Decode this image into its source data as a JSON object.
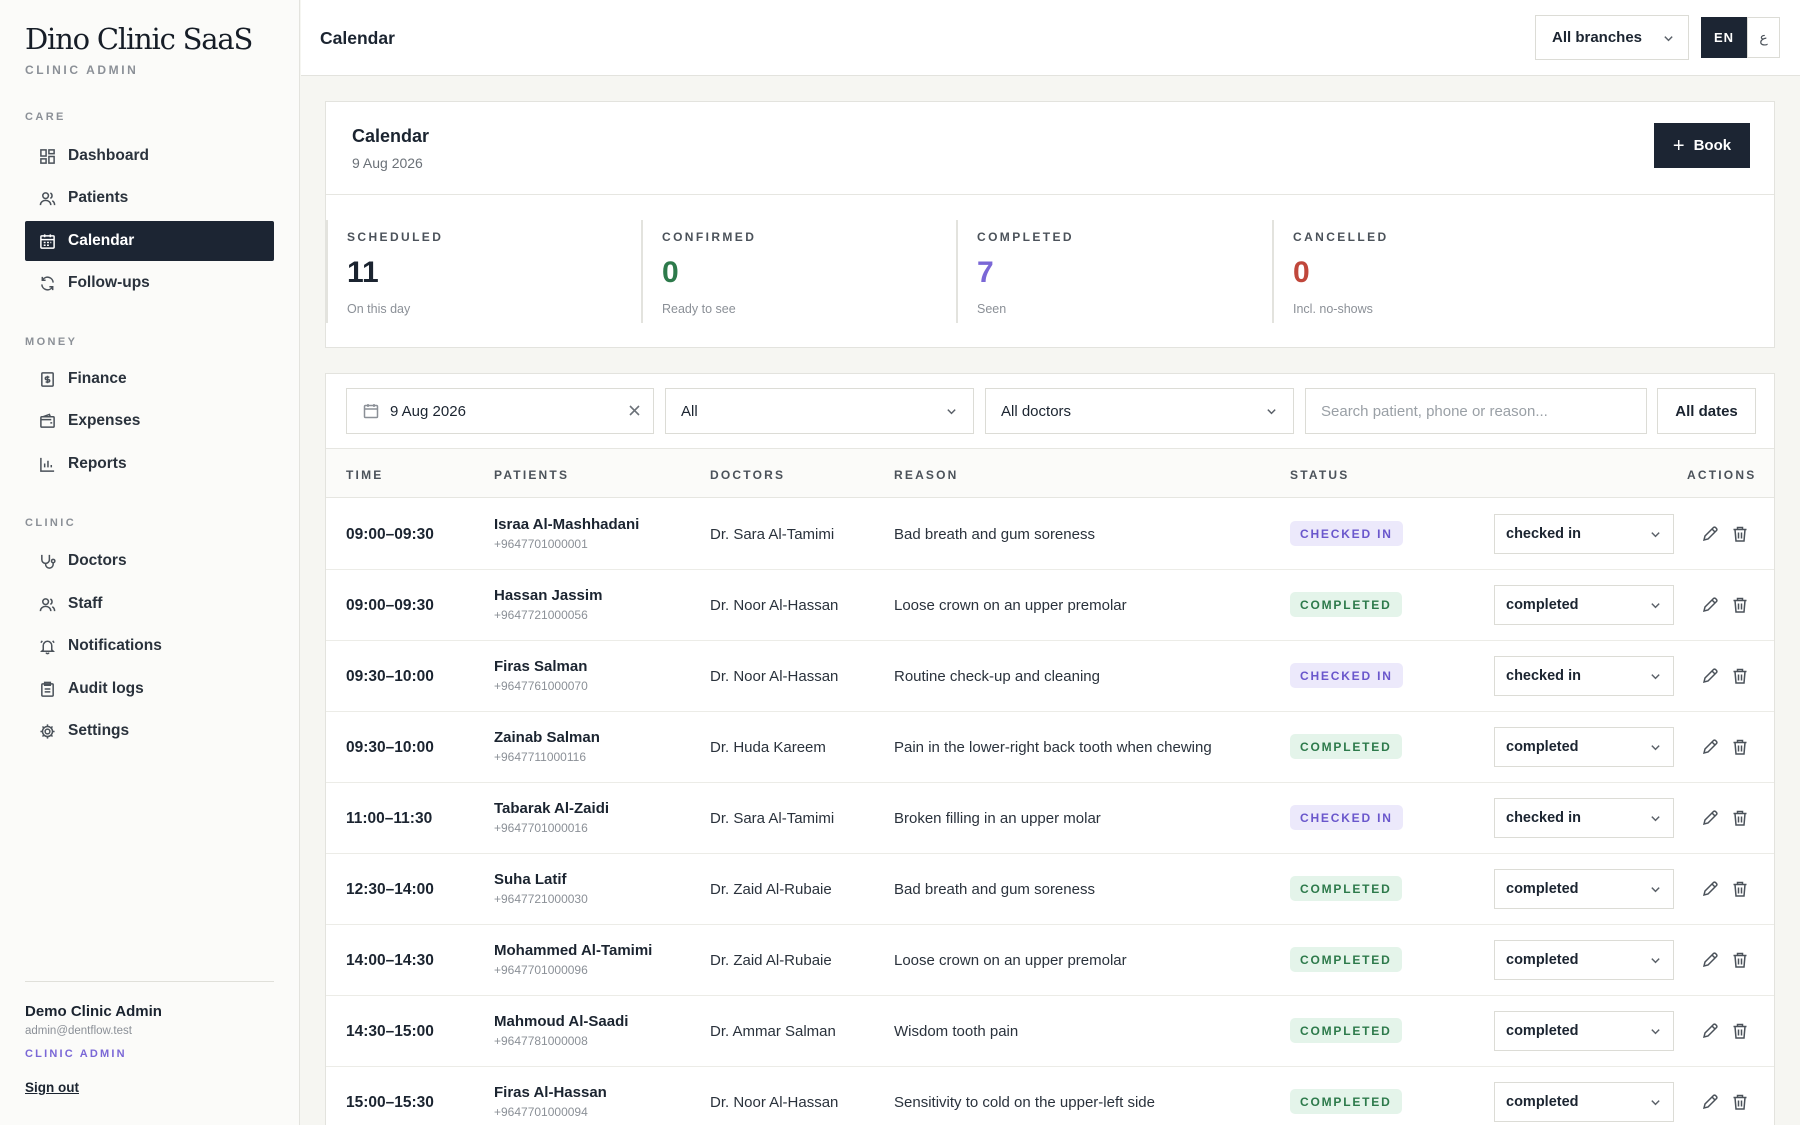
{
  "sidebar": {
    "brand": "Dino Clinic SaaS",
    "brand_sub": "CLINIC ADMIN",
    "sections": {
      "care": "CARE",
      "money": "MONEY",
      "clinic": "CLINIC"
    },
    "items": [
      {
        "label": "Dashboard",
        "icon": "dashboard-icon"
      },
      {
        "label": "Patients",
        "icon": "users-icon"
      },
      {
        "label": "Calendar",
        "icon": "calendar-icon",
        "active": true
      },
      {
        "label": "Follow-ups",
        "icon": "refresh-icon"
      },
      {
        "label": "Finance",
        "icon": "receipt-icon"
      },
      {
        "label": "Expenses",
        "icon": "wallet-icon"
      },
      {
        "label": "Reports",
        "icon": "bar-chart-icon"
      },
      {
        "label": "Doctors",
        "icon": "stethoscope-icon"
      },
      {
        "label": "Staff",
        "icon": "users-icon"
      },
      {
        "label": "Notifications",
        "icon": "bell-icon"
      },
      {
        "label": "Audit logs",
        "icon": "clipboard-icon"
      },
      {
        "label": "Settings",
        "icon": "gear-icon"
      }
    ],
    "user": {
      "name": "Demo Clinic Admin",
      "email": "admin@dentflow.test",
      "role": "CLINIC ADMIN",
      "sign_out": "Sign out"
    }
  },
  "topbar": {
    "title": "Calendar",
    "branch": "All branches",
    "lang_en": "EN",
    "lang_ar": "ع"
  },
  "summary": {
    "title": "Calendar",
    "date": "9 Aug 2026",
    "book_label": "Book",
    "stats": [
      {
        "label": "SCHEDULED",
        "value": "11",
        "sub": "On this day",
        "color": "#1b2430"
      },
      {
        "label": "CONFIRMED",
        "value": "0",
        "sub": "Ready to see",
        "color": "#2d7a4b"
      },
      {
        "label": "COMPLETED",
        "value": "7",
        "sub": "Seen",
        "color": "#7a67d6"
      },
      {
        "label": "CANCELLED",
        "value": "0",
        "sub": "Incl. no-shows",
        "color": "#c0473b"
      }
    ]
  },
  "filters": {
    "date": "9 Aug 2026",
    "status": "All",
    "doctor": "All doctors",
    "search_placeholder": "Search patient, phone or reason...",
    "all_dates": "All dates"
  },
  "table": {
    "headers": {
      "time": "TIME",
      "patients": "PATIENTS",
      "doctors": "DOCTORS",
      "reason": "REASON",
      "status": "STATUS",
      "actions": "ACTIONS"
    },
    "rows": [
      {
        "time": "09:00–09:30",
        "name": "Israa Al-Mashhadani",
        "phone": "+9647701000001",
        "doctor": "Dr. Sara Al-Tamimi",
        "reason": "Bad breath and gum soreness",
        "badge": "CHECKED IN",
        "kind": "checked",
        "select": "checked in"
      },
      {
        "time": "09:00–09:30",
        "name": "Hassan Jassim",
        "phone": "+9647721000056",
        "doctor": "Dr. Noor Al-Hassan",
        "reason": "Loose crown on an upper premolar",
        "badge": "COMPLETED",
        "kind": "completed",
        "select": "completed"
      },
      {
        "time": "09:30–10:00",
        "name": "Firas Salman",
        "phone": "+9647761000070",
        "doctor": "Dr. Noor Al-Hassan",
        "reason": "Routine check-up and cleaning",
        "badge": "CHECKED IN",
        "kind": "checked",
        "select": "checked in"
      },
      {
        "time": "09:30–10:00",
        "name": "Zainab Salman",
        "phone": "+9647711000116",
        "doctor": "Dr. Huda Kareem",
        "reason": "Pain in the lower-right back tooth when chewing",
        "badge": "COMPLETED",
        "kind": "completed",
        "select": "completed"
      },
      {
        "time": "11:00–11:30",
        "name": "Tabarak Al-Zaidi",
        "phone": "+9647701000016",
        "doctor": "Dr. Sara Al-Tamimi",
        "reason": "Broken filling in an upper molar",
        "badge": "CHECKED IN",
        "kind": "checked",
        "select": "checked in"
      },
      {
        "time": "12:30–14:00",
        "name": "Suha Latif",
        "phone": "+9647721000030",
        "doctor": "Dr. Zaid Al-Rubaie",
        "reason": "Bad breath and gum soreness",
        "badge": "COMPLETED",
        "kind": "completed",
        "select": "completed"
      },
      {
        "time": "14:00–14:30",
        "name": "Mohammed Al-Tamimi",
        "phone": "+9647701000096",
        "doctor": "Dr. Zaid Al-Rubaie",
        "reason": "Loose crown on an upper premolar",
        "badge": "COMPLETED",
        "kind": "completed",
        "select": "completed"
      },
      {
        "time": "14:30–15:00",
        "name": "Mahmoud Al-Saadi",
        "phone": "+9647781000008",
        "doctor": "Dr. Ammar Salman",
        "reason": "Wisdom tooth pain",
        "badge": "COMPLETED",
        "kind": "completed",
        "select": "completed"
      },
      {
        "time": "15:00–15:30",
        "name": "Firas Al-Hassan",
        "phone": "+9647701000094",
        "doctor": "Dr. Noor Al-Hassan",
        "reason": "Sensitivity to cold on the upper-left side",
        "badge": "COMPLETED",
        "kind": "completed",
        "select": "completed"
      }
    ]
  }
}
